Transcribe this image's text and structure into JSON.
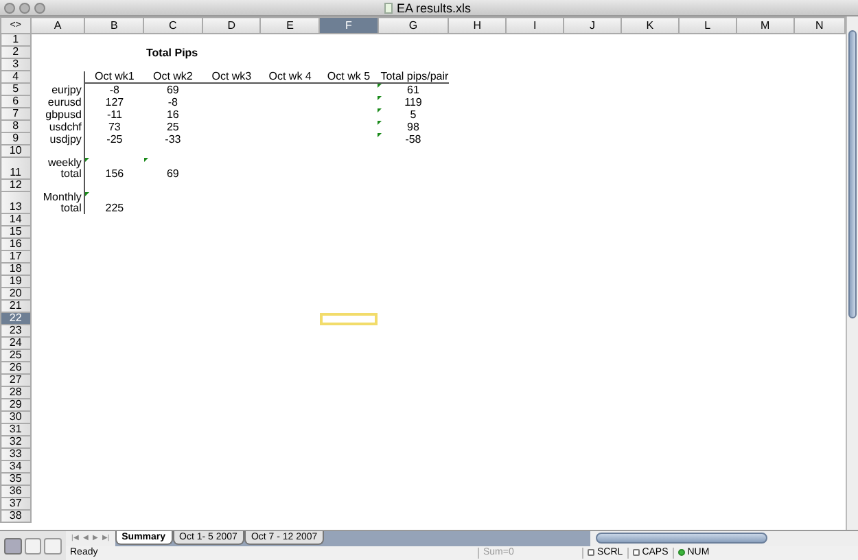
{
  "window": {
    "title": "EA results.xls"
  },
  "corner": "<>",
  "columns": [
    {
      "label": "A",
      "selected": false
    },
    {
      "label": "B",
      "selected": false
    },
    {
      "label": "C",
      "selected": false
    },
    {
      "label": "D",
      "selected": false
    },
    {
      "label": "E",
      "selected": false
    },
    {
      "label": "F",
      "selected": true
    },
    {
      "label": "G",
      "selected": false
    },
    {
      "label": "H",
      "selected": false
    },
    {
      "label": "I",
      "selected": false
    },
    {
      "label": "J",
      "selected": false
    },
    {
      "label": "K",
      "selected": false
    },
    {
      "label": "L",
      "selected": false
    },
    {
      "label": "M",
      "selected": false
    },
    {
      "label": "N",
      "selected": false
    }
  ],
  "rows": [
    {
      "number": "1",
      "selected": false
    },
    {
      "number": "2",
      "selected": false,
      "cells": {
        "C": {
          "text": "Total Pips",
          "kind": "heading",
          "flag": false
        }
      }
    },
    {
      "number": "3",
      "selected": false
    },
    {
      "number": "4",
      "selected": false,
      "cells": {
        "B": {
          "text": "Oct wk1",
          "kind": "center",
          "flag": false
        },
        "C": {
          "text": "Oct wk2",
          "kind": "center",
          "flag": false
        },
        "D": {
          "text": "Oct wk3",
          "kind": "center",
          "flag": false
        },
        "E": {
          "text": "Oct wk 4",
          "kind": "center",
          "flag": false
        },
        "F": {
          "text": "Oct wk 5",
          "kind": "center",
          "flag": false
        },
        "G": {
          "text": "Total pips/pair",
          "kind": "left",
          "flag": false
        }
      }
    },
    {
      "number": "5",
      "selected": false,
      "cells": {
        "A": {
          "text": "eurjpy",
          "kind": "right",
          "flag": false
        },
        "B": {
          "text": "-8",
          "kind": "center",
          "flag": false
        },
        "C": {
          "text": "69",
          "kind": "center",
          "flag": false
        },
        "G": {
          "text": "61",
          "kind": "center",
          "flag": true
        }
      }
    },
    {
      "number": "6",
      "selected": false,
      "cells": {
        "A": {
          "text": "eurusd",
          "kind": "right",
          "flag": false
        },
        "B": {
          "text": "127",
          "kind": "center",
          "flag": false
        },
        "C": {
          "text": "-8",
          "kind": "center",
          "flag": false
        },
        "G": {
          "text": "119",
          "kind": "center",
          "flag": true
        }
      }
    },
    {
      "number": "7",
      "selected": false,
      "cells": {
        "A": {
          "text": "gbpusd",
          "kind": "right",
          "flag": false
        },
        "B": {
          "text": "-11",
          "kind": "center",
          "flag": false
        },
        "C": {
          "text": "16",
          "kind": "center",
          "flag": false
        },
        "G": {
          "text": "5",
          "kind": "center",
          "flag": true
        }
      }
    },
    {
      "number": "8",
      "selected": false,
      "cells": {
        "A": {
          "text": "usdchf",
          "kind": "right",
          "flag": false
        },
        "B": {
          "text": "73",
          "kind": "center",
          "flag": false
        },
        "C": {
          "text": "25",
          "kind": "center",
          "flag": false
        },
        "G": {
          "text": "98",
          "kind": "center",
          "flag": true
        }
      }
    },
    {
      "number": "9",
      "selected": false,
      "cells": {
        "A": {
          "text": "usdjpy",
          "kind": "right",
          "flag": false
        },
        "B": {
          "text": "-25",
          "kind": "center",
          "flag": false
        },
        "C": {
          "text": "-33",
          "kind": "center",
          "flag": false
        },
        "G": {
          "text": "-58",
          "kind": "center",
          "flag": true
        }
      }
    },
    {
      "number": "10",
      "selected": false
    },
    {
      "number": "11",
      "selected": false,
      "cells": {
        "A": {
          "text": "weekly\ntotal",
          "kind": "right",
          "flag": false
        },
        "B": {
          "text": "156",
          "kind": "center",
          "flag": true
        },
        "C": {
          "text": "69",
          "kind": "center",
          "flag": true
        }
      }
    },
    {
      "number": "12",
      "selected": false
    },
    {
      "number": "13",
      "selected": false,
      "cells": {
        "A": {
          "text": "Monthly\ntotal",
          "kind": "right",
          "flag": false
        },
        "B": {
          "text": "225",
          "kind": "center",
          "flag": true
        }
      }
    },
    {
      "number": "14",
      "selected": false
    },
    {
      "number": "15",
      "selected": false
    },
    {
      "number": "16",
      "selected": false
    },
    {
      "number": "17",
      "selected": false
    },
    {
      "number": "18",
      "selected": false
    },
    {
      "number": "19",
      "selected": false
    },
    {
      "number": "20",
      "selected": false
    },
    {
      "number": "21",
      "selected": false
    },
    {
      "number": "22",
      "selected": true
    },
    {
      "number": "23",
      "selected": false
    },
    {
      "number": "24",
      "selected": false
    },
    {
      "number": "25",
      "selected": false
    },
    {
      "number": "26",
      "selected": false
    },
    {
      "number": "27",
      "selected": false
    },
    {
      "number": "28",
      "selected": false
    },
    {
      "number": "29",
      "selected": false
    },
    {
      "number": "30",
      "selected": false
    },
    {
      "number": "31",
      "selected": false
    },
    {
      "number": "32",
      "selected": false
    },
    {
      "number": "33",
      "selected": false
    },
    {
      "number": "34",
      "selected": false
    },
    {
      "number": "35",
      "selected": false
    },
    {
      "number": "36",
      "selected": false
    },
    {
      "number": "37",
      "selected": false
    },
    {
      "number": "38",
      "selected": false
    }
  ],
  "sheet_nav": [
    "|◀",
    "◀",
    "▶",
    "▶|"
  ],
  "sheet_tabs": [
    {
      "label": "Summary",
      "selected": true
    },
    {
      "label": "Oct 1- 5 2007",
      "selected": false
    },
    {
      "label": "Oct 7 - 12 2007",
      "selected": false
    }
  ],
  "status_bar": {
    "message": "Ready",
    "sum": "Sum=0",
    "indicators": [
      {
        "label": "SCRL",
        "on": false
      },
      {
        "label": "CAPS",
        "on": false
      },
      {
        "label": "NUM",
        "on": true
      }
    ]
  }
}
